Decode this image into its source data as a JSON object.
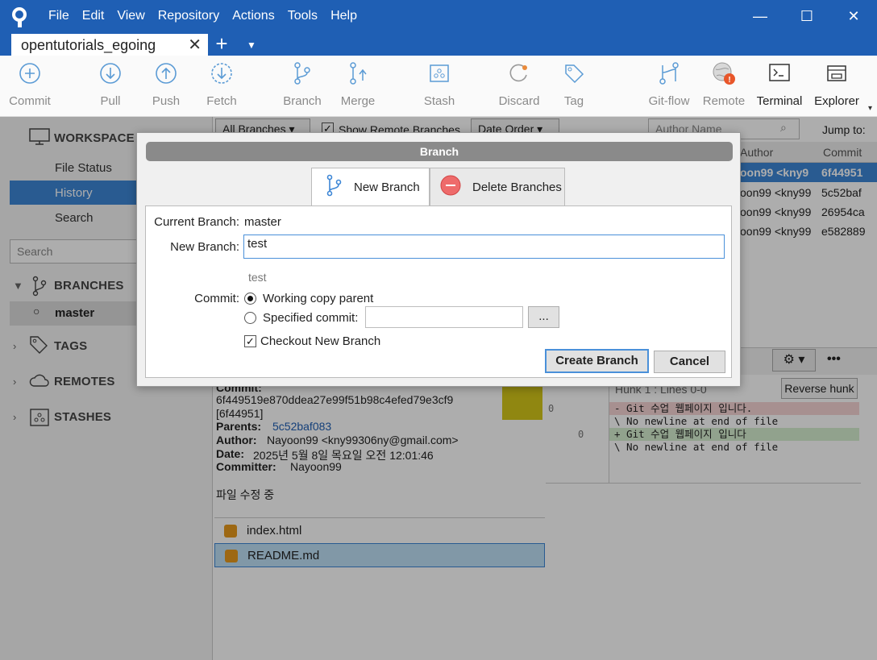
{
  "titlebar": {
    "menu": [
      "File",
      "Edit",
      "View",
      "Repository",
      "Actions",
      "Tools",
      "Help"
    ],
    "window_controls": {
      "minimize": "—",
      "maximize": "☐",
      "close": "✕"
    }
  },
  "tabs": {
    "repo_tab_label": "opentutorials_egoing",
    "close_glyph": "✕",
    "add_glyph": "+",
    "dropdown_glyph": "▼"
  },
  "toolbar": {
    "commit": "Commit",
    "pull": "Pull",
    "push": "Push",
    "fetch": "Fetch",
    "branch": "Branch",
    "merge": "Merge",
    "stash": "Stash",
    "discard": "Discard",
    "tag": "Tag",
    "gitflow": "Git-flow",
    "remote": "Remote",
    "terminal": "Terminal",
    "explorer": "Explorer",
    "more_glyph": "▾"
  },
  "sidebar": {
    "workspace": "WORKSPACE",
    "file_status": "File Status",
    "history": "History",
    "search": "Search",
    "search_placeholder": "Search",
    "branches": "BRANCHES",
    "current_branch": "master",
    "tags": "TAGS",
    "remotes": "REMOTES",
    "stashes": "STASHES"
  },
  "filters": {
    "branches_select": "All Branches",
    "show_remote": "Show Remote Branches",
    "order_select": "Date Order",
    "author_placeholder": "Author Name",
    "jump_to": "Jump to:"
  },
  "commit_list": {
    "columns": {
      "author": "Author",
      "commit": "Commit"
    },
    "rows": [
      {
        "author": "oon99 <kny9",
        "commit": "6f44951",
        "selected": true
      },
      {
        "author": "oon99 <kny99",
        "commit": "5c52baf",
        "selected": false
      },
      {
        "author": "oon99 <kny99",
        "commit": "26954ca",
        "selected": false
      },
      {
        "author": "oon99 <kny99",
        "commit": "e582889",
        "selected": false
      }
    ]
  },
  "details": {
    "commit_label": "Commit:",
    "hash": "6f449519e870ddea27e99f51b98c4efed79e3cf9",
    "short_hash": "[6f44951]",
    "parents_label": "Parents:",
    "parents_value": "5c52baf083",
    "author_label": "Author:",
    "author_value": "Nayoon99 <kny99306ny@gmail.com>",
    "date_label": "Date:",
    "date_value": "2025년 5월 8일 목요일 오전 12:01:46",
    "committer_label": "Committer:",
    "committer_value": "Nayoon99",
    "message": "파일 수정 중",
    "files": [
      "index.html",
      "README.md"
    ]
  },
  "diff": {
    "hunk_header": "Hunk 1 : Lines 0-0",
    "reverse_hunk": "Reverse hunk",
    "old_line_no": "0",
    "new_line_no": "0",
    "lines": [
      {
        "text": "- Git 수업 웹페이지 입니다.",
        "type": "del"
      },
      {
        "text": "\\  No newline at end of file",
        "type": "meta"
      },
      {
        "text": "+ Git 수업 웹페이지 입니다",
        "type": "add"
      },
      {
        "text": "\\  No newline at end of file",
        "type": "meta"
      }
    ],
    "more_glyph": "•••"
  },
  "dialog": {
    "title": "Branch",
    "tab_new": "New Branch",
    "tab_delete": "Delete Branches",
    "current_branch_label": "Current Branch:",
    "current_branch_value": "master",
    "new_branch_label": "New Branch:",
    "new_branch_value": "test",
    "preview": "test",
    "commit_label": "Commit:",
    "opt_working_copy": "Working copy parent",
    "opt_specified": "Specified commit:",
    "specified_value": "",
    "browse_label": "...",
    "checkout_label": "Checkout New Branch",
    "checkout_checked": true,
    "create_button": "Create Branch",
    "cancel_button": "Cancel"
  },
  "colors": {
    "titlebar": "#1f5fb4",
    "accent": "#3d86d6",
    "delete_red": "#e04848",
    "diff_del": "#f6d5d5",
    "diff_add": "#d6efd0"
  }
}
